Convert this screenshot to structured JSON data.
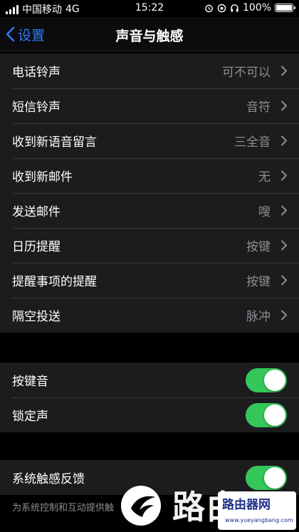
{
  "status": {
    "carrier": "中国移动",
    "network": "4G",
    "time": "15:22",
    "battery": "100%"
  },
  "nav": {
    "back_label": "设置",
    "title": "声音与触感"
  },
  "sounds": [
    {
      "label": "电话铃声",
      "value": "可不可以"
    },
    {
      "label": "短信铃声",
      "value": "音符"
    },
    {
      "label": "收到新语音留言",
      "value": "三全音"
    },
    {
      "label": "收到新邮件",
      "value": "无"
    },
    {
      "label": "发送邮件",
      "value": "嗖"
    },
    {
      "label": "日历提醒",
      "value": "按键"
    },
    {
      "label": "提醒事项的提醒",
      "value": "按键"
    },
    {
      "label": "隔空投送",
      "value": "脉冲"
    }
  ],
  "toggles": [
    {
      "label": "按键音",
      "on": true
    },
    {
      "label": "锁定声",
      "on": true
    }
  ],
  "haptics": {
    "label": "系统触感反馈",
    "on": true
  },
  "footnote": "为系统控制和互动提供触",
  "watermark": {
    "text": "路由器",
    "box_main": "路由器网",
    "box_sub": "www.yueyangbang.com"
  },
  "colors": {
    "accent": "#2f7cf6",
    "toggle_on": "#34c759",
    "group_bg": "#1c1c1e"
  }
}
